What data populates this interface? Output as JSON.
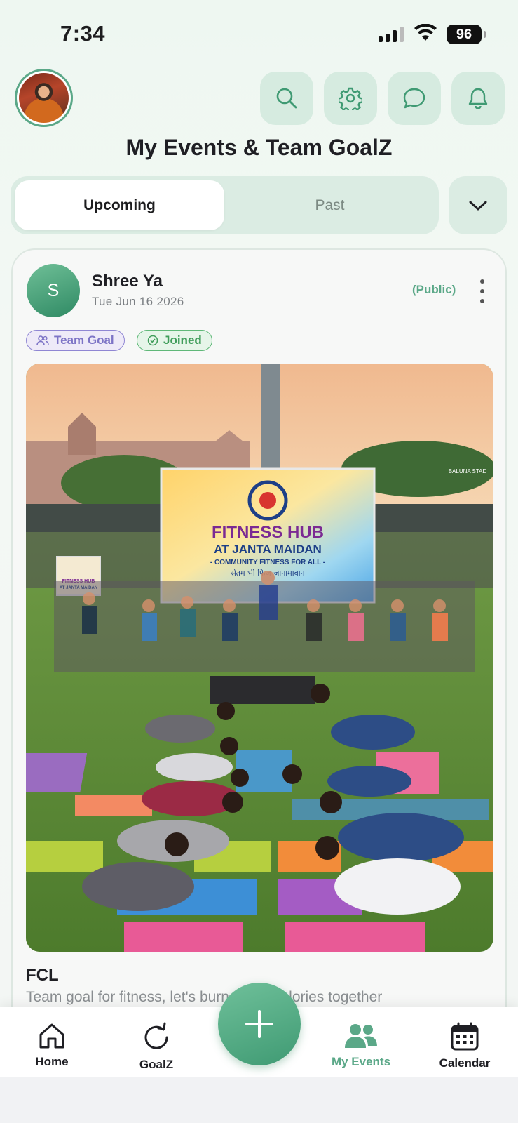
{
  "status_bar": {
    "time": "7:34",
    "battery": "96"
  },
  "header": {
    "title": "My Events & Team GoalZ",
    "buttons": [
      "search-icon",
      "gear-icon",
      "chat-icon",
      "bell-icon"
    ]
  },
  "tabs": {
    "upcoming": "Upcoming",
    "past": "Past",
    "selected": "Upcoming"
  },
  "event": {
    "organizer_initial": "S",
    "organizer_name": "Shree Ya",
    "date": "Tue Jun 16 2026",
    "visibility": "(Public)",
    "tags": {
      "team_goal": "Team Goal",
      "joined": "Joined"
    },
    "image": {
      "banner_line1": "FITNESS HUB",
      "banner_line2": "AT JANTA MAIDAN",
      "banner_line3": "- COMMUNITY FITNESS FOR ALL -",
      "banner_line4": "सेतम भी फिज जानामावान",
      "small_sign_line1": "FITNESS HUB",
      "small_sign_line2": "AT JANTA MAIDAN",
      "gate_sign": "BALUNA STAD"
    },
    "name": "FCL",
    "description": "Team goal for fitness, let's burn some calories together"
  },
  "bottom_nav": {
    "items": [
      {
        "label": "Home",
        "icon": "home-icon"
      },
      {
        "label": "GoalZ",
        "icon": "refresh-icon"
      },
      {
        "label": "My Events",
        "icon": "people-icon",
        "active": true
      },
      {
        "label": "Calendar",
        "icon": "calendar-icon"
      }
    ],
    "fab_icon": "plus-icon"
  },
  "colors": {
    "accent": "#5ba888",
    "tab_bg": "#dbece3",
    "team_goal": "#7d74c6",
    "joined": "#3f9d5a"
  }
}
